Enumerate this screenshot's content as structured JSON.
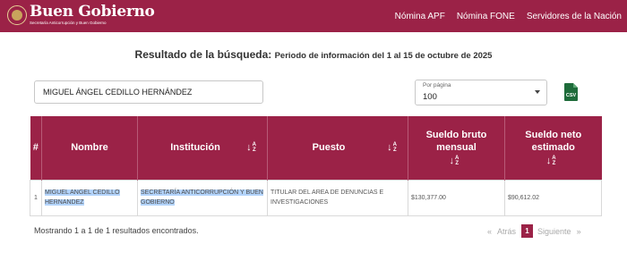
{
  "header": {
    "brand_title": "Buen Gobierno",
    "brand_subtitle": "Secretaría Anticorrupción y Buen Gobierno",
    "nav": [
      "Nómina APF",
      "Nómina FONE",
      "Servidores de la Nación"
    ]
  },
  "page": {
    "title_main": "Resultado de la búsqueda:",
    "title_period": "Periodo de información del 1 al 15 de octubre de 2025"
  },
  "search": {
    "value": "MIGUEL ÁNGEL CEDILLO HERNÁNDEZ"
  },
  "per_page": {
    "label": "Por página",
    "value": "100"
  },
  "export": {
    "icon": "csv-file-icon",
    "label": "CSV"
  },
  "table": {
    "columns": [
      "#",
      "Nombre",
      "Institución",
      "Puesto",
      "Sueldo bruto mensual",
      "Sueldo neto estimado"
    ],
    "sort_glyph_top": "A",
    "sort_glyph_bottom": "Z",
    "rows": [
      {
        "index": "1",
        "nombre": "MIGUEL ANGEL CEDILLO HERNANDEZ",
        "institucion": "SECRETARÍA ANTICORRUPCIÓN Y BUEN GOBIERNO",
        "puesto": "TITULAR DEL AREA DE DENUNCIAS E INVESTIGACIONES",
        "sueldo_bruto": "$130,377.00",
        "sueldo_neto": "$90,612.02"
      }
    ]
  },
  "footer": {
    "summary": "Mostrando 1 a 1 de 1 resultados encontrados.",
    "prev_arrow": "«",
    "prev": "Atrás",
    "current_page": "1",
    "next": "Siguiente",
    "next_arrow": "»"
  },
  "colors": {
    "brand": "#9b2247",
    "highlight": "#b3d4fc",
    "csv_green": "#1e6b3a"
  }
}
